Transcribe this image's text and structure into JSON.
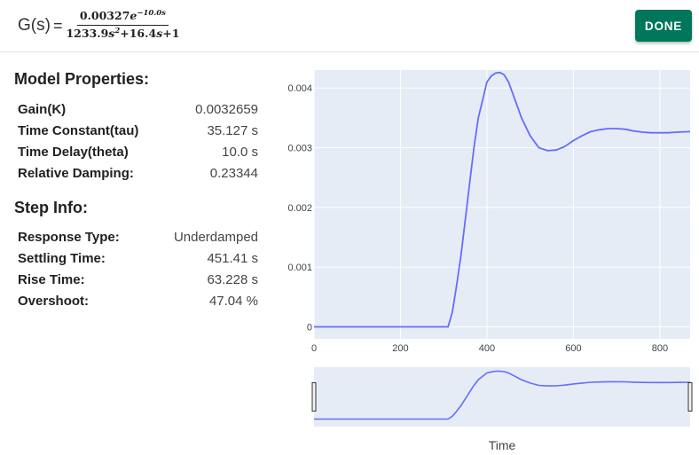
{
  "header": {
    "tf_label": "G(s)",
    "tf_equals": "=",
    "tf_num_coef": "0.00327",
    "tf_num_var": "e",
    "tf_num_exp": "−10.0s",
    "tf_den_a": "1233.9",
    "tf_den_s1": "s",
    "tf_den_pow": "2",
    "tf_den_b": "+16.4",
    "tf_den_s2": "s",
    "tf_den_c": "+1",
    "done_label": "DONE"
  },
  "model": {
    "title": "Model Properties:",
    "rows": [
      {
        "key": "Gain(K)",
        "value": "0.0032659"
      },
      {
        "key": "Time Constant(tau)",
        "value": "35.127 s"
      },
      {
        "key": "Time Delay(theta)",
        "value": "10.0 s"
      },
      {
        "key": "Relative Damping:",
        "value": "0.23344"
      }
    ]
  },
  "step": {
    "title": "Step Info:",
    "rows": [
      {
        "key": "Response Type:",
        "value": "Underdamped"
      },
      {
        "key": "Settling Time:",
        "value": "451.41 s"
      },
      {
        "key": "Rise Time:",
        "value": "63.228 s"
      },
      {
        "key": "Overshoot:",
        "value": "47.04 %"
      }
    ]
  },
  "chart_data": {
    "type": "line",
    "title": "",
    "xlabel": "Time",
    "ylabel": "",
    "xlim": [
      0,
      870
    ],
    "ylim": [
      -0.0002,
      0.0043
    ],
    "x_ticks": [
      0,
      200,
      400,
      600,
      800
    ],
    "x_tick_labels": [
      "0",
      "200",
      "400",
      "600",
      "800"
    ],
    "y_ticks": [
      0,
      0.001,
      0.002,
      0.003,
      0.004
    ],
    "y_tick_labels": [
      "0",
      "0.001",
      "0.002",
      "0.003",
      "0.004"
    ],
    "grid": true,
    "colors": {
      "line": "#636efa",
      "plot_bg": "#e5ecf6",
      "grid": "#ffffff"
    },
    "range_slider": true,
    "series": [
      {
        "values_x": [
          0,
          100,
          200,
          300,
          310,
          320,
          330,
          340,
          350,
          360,
          370,
          380,
          390,
          400,
          410,
          420,
          430,
          440,
          450,
          460,
          470,
          480,
          500,
          520,
          540,
          560,
          580,
          600,
          620,
          640,
          660,
          680,
          700,
          720,
          740,
          760,
          780,
          800,
          820,
          840,
          870
        ],
        "values_y": [
          0,
          0,
          0,
          0,
          0,
          0.00025,
          0.0007,
          0.0012,
          0.0018,
          0.0024,
          0.003,
          0.0035,
          0.0038,
          0.0041,
          0.0042,
          0.00425,
          0.00426,
          0.00422,
          0.0041,
          0.0039,
          0.0037,
          0.0035,
          0.0032,
          0.003,
          0.00295,
          0.00296,
          0.00302,
          0.00312,
          0.0032,
          0.00327,
          0.0033,
          0.00332,
          0.00332,
          0.00331,
          0.00328,
          0.00326,
          0.00325,
          0.00325,
          0.00325,
          0.00326,
          0.00327
        ]
      }
    ]
  }
}
